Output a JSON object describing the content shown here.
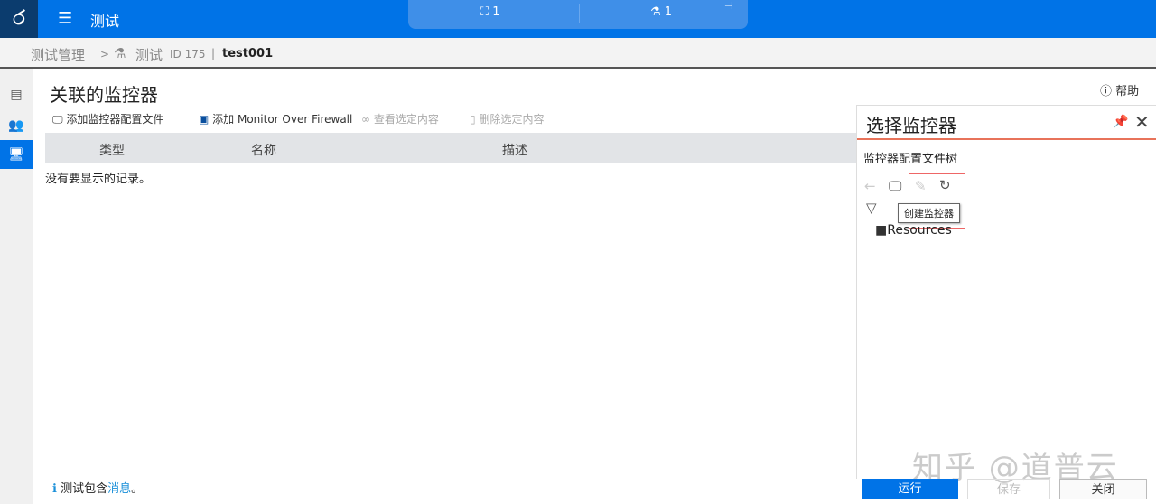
{
  "header": {
    "logo": "ර",
    "title": "测试",
    "pill": {
      "runs_count": "1",
      "tests_count": "1"
    }
  },
  "breadcrumb": {
    "root": "测试管理",
    "sep": ">",
    "item": "测试",
    "id": "ID 175",
    "divider": "|",
    "name": "test001"
  },
  "sidebar": {
    "items": [
      {
        "icon": "details-icon"
      },
      {
        "icon": "users-icon"
      },
      {
        "icon": "monitor-icon",
        "active": true
      }
    ]
  },
  "main": {
    "title": "关联的监控器",
    "help": "帮助",
    "toolbar": {
      "add_profile": "添加监控器配置文件",
      "add_mof": "添加 Monitor Over Firewall",
      "view": "查看选定内容",
      "delete": "删除选定内容"
    },
    "table": {
      "columns": [
        "类型",
        "名称",
        "描述"
      ],
      "empty": "没有要显示的记录。"
    }
  },
  "panel": {
    "title": "选择监控器",
    "tree_label": "监控器配置文件树",
    "tooltip": "创建监控器",
    "root_node": "Resources"
  },
  "footer": {
    "info_prefix": "测试包含",
    "info_link": "消息",
    "info_suffix": "。",
    "run": "运行",
    "save": "保存",
    "close": "关闭"
  },
  "watermark": "知乎 @道普云",
  "colors": {
    "primary": "#0073e7",
    "accent_line": "#e8735a"
  }
}
